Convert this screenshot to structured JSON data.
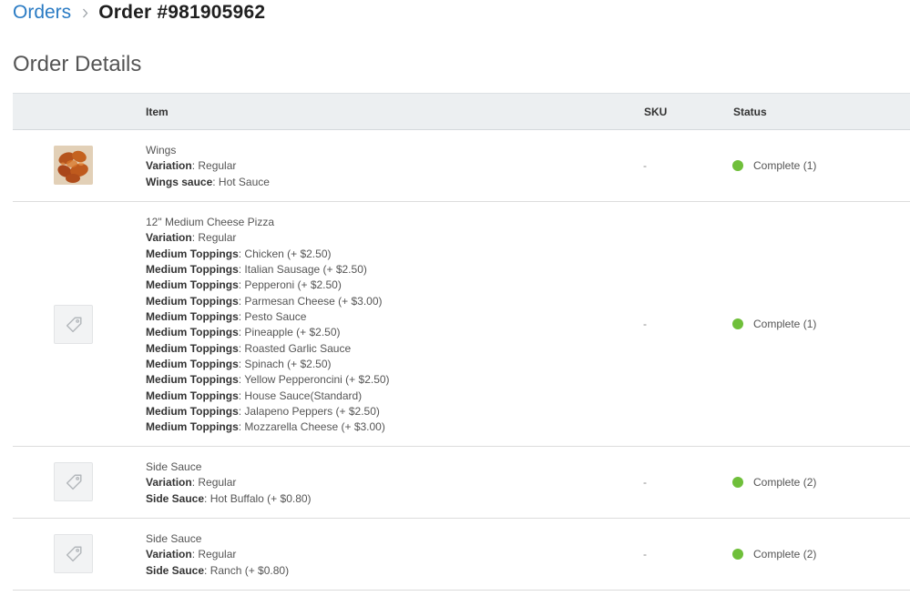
{
  "breadcrumb": {
    "parent": "Orders",
    "current": "Order #981905962"
  },
  "section_title": "Order Details",
  "table": {
    "columns": {
      "item": "Item",
      "sku": "SKU",
      "status": "Status"
    },
    "rows": [
      {
        "name": "Wings",
        "image": "wings-photo",
        "attributes": [
          {
            "label": "Variation",
            "value": ": Regular"
          },
          {
            "label": "Wings sauce",
            "value": ": Hot Sauce"
          }
        ],
        "sku": "-",
        "status": "Complete (1)"
      },
      {
        "name": "12\" Medium Cheese Pizza",
        "image": "tag-icon",
        "attributes": [
          {
            "label": "Variation",
            "value": ": Regular"
          },
          {
            "label": "Medium Toppings",
            "value": ": Chicken (+ $2.50)"
          },
          {
            "label": "Medium Toppings",
            "value": ": Italian Sausage (+ $2.50)"
          },
          {
            "label": "Medium Toppings",
            "value": ": Pepperoni (+ $2.50)"
          },
          {
            "label": "Medium Toppings",
            "value": ": Parmesan Cheese (+ $3.00)"
          },
          {
            "label": "Medium Toppings",
            "value": ": Pesto Sauce"
          },
          {
            "label": "Medium Toppings",
            "value": ": Pineapple (+ $2.50)"
          },
          {
            "label": "Medium Toppings",
            "value": ": Roasted Garlic Sauce"
          },
          {
            "label": "Medium Toppings",
            "value": ": Spinach (+ $2.50)"
          },
          {
            "label": "Medium Toppings",
            "value": ": Yellow Pepperoncini (+ $2.50)"
          },
          {
            "label": "Medium Toppings",
            "value": ": House Sauce(Standard)"
          },
          {
            "label": "Medium Toppings",
            "value": ": Jalapeno Peppers (+ $2.50)"
          },
          {
            "label": "Medium Toppings",
            "value": ": Mozzarella Cheese (+ $3.00)"
          }
        ],
        "sku": "-",
        "status": "Complete (1)"
      },
      {
        "name": "Side Sauce",
        "image": "tag-icon",
        "attributes": [
          {
            "label": "Variation",
            "value": ": Regular"
          },
          {
            "label": "Side Sauce",
            "value": ": Hot Buffalo (+ $0.80)"
          }
        ],
        "sku": "-",
        "status": "Complete (2)"
      },
      {
        "name": "Side Sauce",
        "image": "tag-icon",
        "attributes": [
          {
            "label": "Variation",
            "value": ": Regular"
          },
          {
            "label": "Side Sauce",
            "value": ": Ranch (+ $0.80)"
          }
        ],
        "sku": "-",
        "status": "Complete (2)"
      }
    ]
  },
  "colors": {
    "link": "#2a7bc4",
    "status_complete": "#6fbf3a",
    "header_bg": "#eceff1"
  }
}
